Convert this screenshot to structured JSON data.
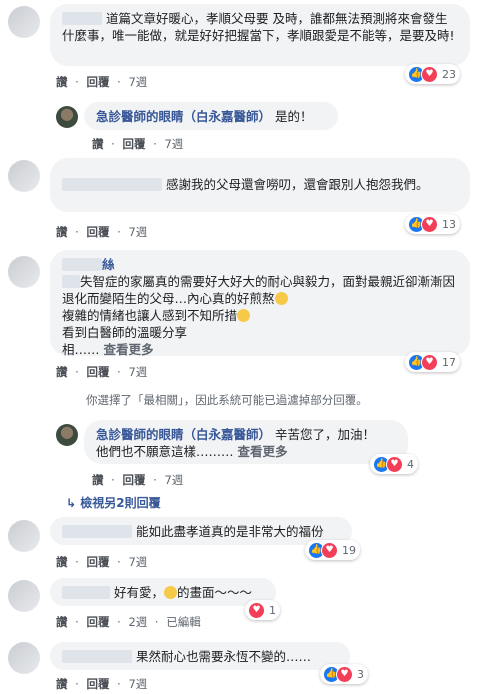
{
  "comments": [
    {
      "text": "道篇文章好暖心，孝順父母要 及時，誰都無法預測將來會發生什麼事，唯一能做，就是好好把握當下，孝順跟愛是不能等，是要及時!",
      "reaction_count": "23"
    },
    {
      "text": "感謝我的父母還會嘮叨，還會跟別人抱怨我們。",
      "reaction_count": "13"
    },
    {
      "partial_name": "絲",
      "lines": [
        "失智症的家屬真的需要好大好大的耐心與毅力，面對最親近卻漸漸因退化而變陌生的父母…內心真的好煎熬",
        "複雜的情緒也讓人感到不知所措",
        "看到白醫師的溫暖分享",
        "相……"
      ],
      "see_more": "查看更多",
      "reaction_count": "17"
    },
    {
      "text": "能如此盡孝道真的是非常大的福份",
      "reaction_count": "19"
    },
    {
      "text": "好有愛，",
      "text_after": "的畫面～～～",
      "reaction_count": "1"
    },
    {
      "text": "果然耐心也需要永恆不變的……",
      "reaction_count": "3"
    }
  ],
  "replies": [
    {
      "author": "急診醫師的眼睛（白永嘉醫師）",
      "text": "是的！"
    },
    {
      "author": "急診醫師的眼睛（白永嘉醫師）",
      "text": "辛苦您了，加油！",
      "line2": "他們也不願意這樣…",
      "ellipsis": "……",
      "see_more": "查看更多",
      "reaction_count": "4"
    }
  ],
  "actions": {
    "like": "讚",
    "reply": "回覆",
    "sep": "·",
    "time_7w": "7週",
    "time_2w": "2週",
    "edited": "已編輯"
  },
  "notice": "你選擇了「最相關」，因此系統可能已過濾掉部分回覆。",
  "view_more_replies": "檢視另2則回覆",
  "colors": {
    "like_blue": "#1877f2",
    "love_red": "#f33e58",
    "name_blue": "#385898",
    "bubble_bg": "#f2f3f5"
  }
}
